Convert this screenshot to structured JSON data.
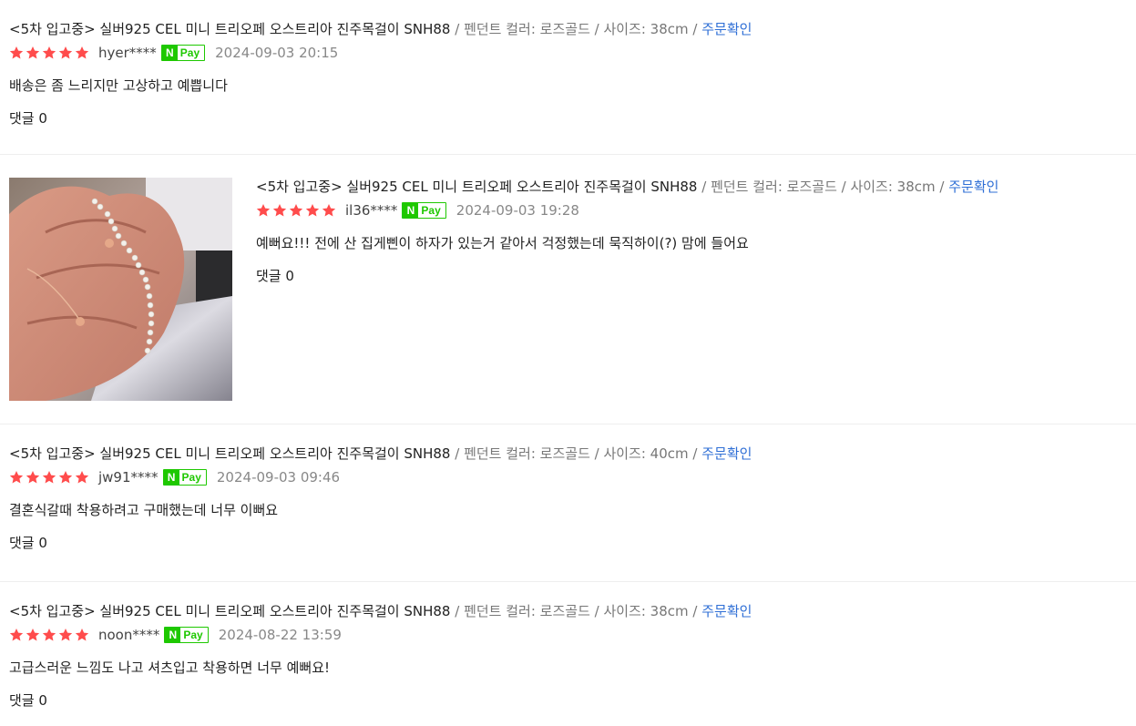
{
  "colors": {
    "star": "#ff4c4c",
    "npay_green": "#1ec800",
    "link_blue": "#2f6fd6",
    "muted": "#777777"
  },
  "reviews": [
    {
      "product": "<5차 입고중> 실버925 CEL 미니 트리오페 오스트리아 진주목걸이 SNH88",
      "options": " / 펜던트 컬러: 로즈골드 / 사이즈: 38cm / ",
      "order_link": "주문확인",
      "rating": 5,
      "user": "hyer****",
      "pay_badge": {
        "n": "N",
        "pay": "Pay"
      },
      "date": "2024-09-03 20:15",
      "text": "배송은 좀 느리지만 고상하고 예쁩니다",
      "comments": "댓글 0"
    },
    {
      "product": "<5차 입고중> 실버925 CEL 미니 트리오페 오스트리아 진주목걸이 SNH88",
      "options": " / 펜던트 컬러: 로즈골드 / 사이즈: 38cm / ",
      "order_link": "주문확인",
      "rating": 5,
      "user": "il36****",
      "pay_badge": {
        "n": "N",
        "pay": "Pay"
      },
      "date": "2024-09-03 19:28",
      "text": "예뻐요!!! 전에 산 집게삔이 하자가 있는거 같아서 걱정했는데 묵직하이(?) 맘에 들어요",
      "comments": "댓글 0",
      "photo_icon": "review-photo"
    },
    {
      "product": "<5차 입고중> 실버925 CEL 미니 트리오페 오스트리아 진주목걸이 SNH88",
      "options": " / 펜던트 컬러: 로즈골드 / 사이즈: 40cm / ",
      "order_link": "주문확인",
      "rating": 5,
      "user": "jw91****",
      "pay_badge": {
        "n": "N",
        "pay": "Pay"
      },
      "date": "2024-09-03 09:46",
      "text": "결혼식갈때 착용하려고 구매했는데 너무 이뻐요",
      "comments": "댓글 0"
    },
    {
      "product": "<5차 입고중> 실버925 CEL 미니 트리오페 오스트리아 진주목걸이 SNH88",
      "options": " / 펜던트 컬러: 로즈골드 / 사이즈: 38cm / ",
      "order_link": "주문확인",
      "rating": 5,
      "user": "noon****",
      "pay_badge": {
        "n": "N",
        "pay": "Pay"
      },
      "date": "2024-08-22 13:59",
      "text": "고급스러운 느낌도 나고 셔츠입고 착용하면 너무 예뻐요!",
      "comments": "댓글 0"
    }
  ]
}
